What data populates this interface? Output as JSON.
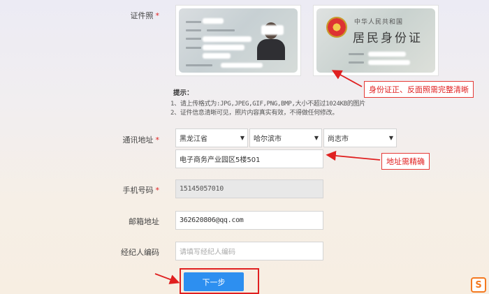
{
  "form": {
    "id_photo": {
      "label": "证件照",
      "required_mark": "*"
    },
    "id_card_back": {
      "title_small": "中华人民共和国",
      "title_large": "居民身份证"
    },
    "hint": {
      "title": "提示：",
      "lines": [
        "1、请上传格式为:JPG,JPEG,GIF,PNG,BMP,大小不超过1024KB的图片",
        "2、证件信息清晰可见，照片内容真实有效，不得做任何修改。"
      ]
    },
    "address": {
      "label": "通讯地址",
      "required_mark": "*",
      "province": "黑龙江省",
      "city": "哈尔滨市",
      "district": "尚志市",
      "detail": "电子商务产业园区5楼501"
    },
    "phone": {
      "label": "手机号码",
      "required_mark": "*",
      "value": "15145057010"
    },
    "email": {
      "label": "邮箱地址",
      "value": "362620806@qq.com"
    },
    "agent": {
      "label": "经纪人编码",
      "placeholder": "请填写经纪人编码"
    },
    "next_button": "下一步"
  },
  "annotations": {
    "id_note": "身份证正、反面照需完整清晰",
    "address_note": "地址需精确"
  },
  "logo_char": "S",
  "colors": {
    "accent": "#2d8ff0",
    "annotation": "#e02020",
    "required": "#e02020"
  }
}
